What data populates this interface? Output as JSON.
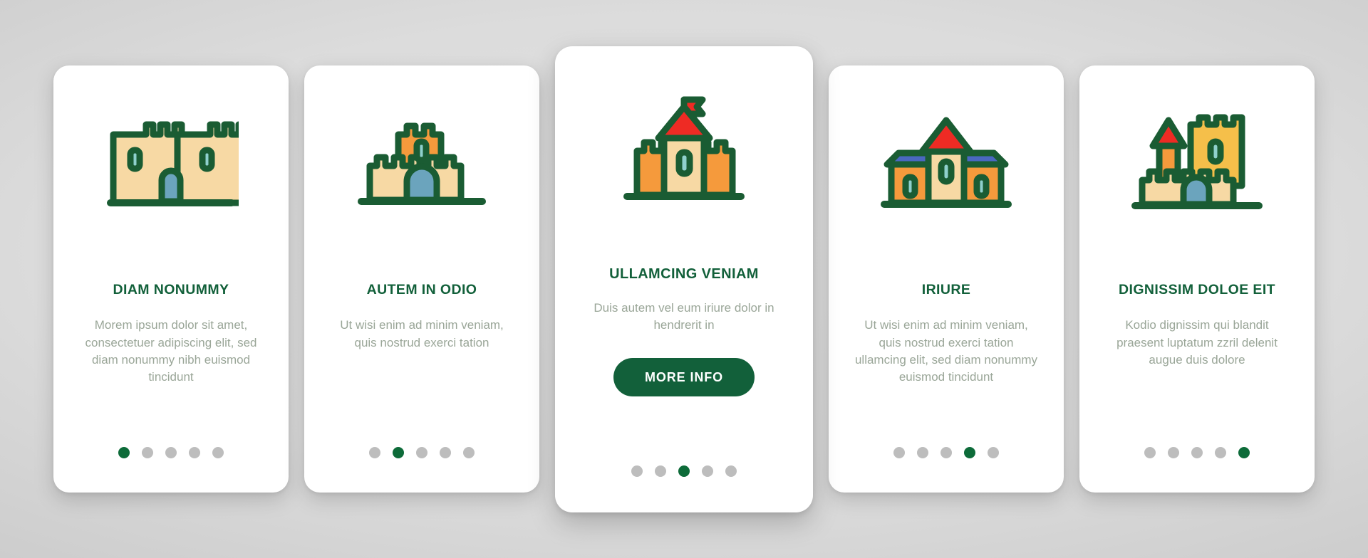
{
  "theme": {
    "accent_green": "#12603a",
    "dot_active": "#0d6b39",
    "dot_inactive": "#bdbdbd",
    "body_text": "#9aa698",
    "card_bg": "#ffffff",
    "page_bg": "#d8d8d8",
    "icon_outline": "#1a5c33",
    "icon_tan": "#f7d9a4",
    "icon_orange": "#f59a3c",
    "icon_gold": "#f5bf4a",
    "icon_red": "#ee2b24",
    "icon_blue": "#6ba4bd",
    "icon_teal": "#8fd0cd",
    "icon_roof_blue": "#4a68c0"
  },
  "cards": [
    {
      "icon_name": "castle-twin-towers-icon",
      "title": "DIAM NONUMMY",
      "body": "Morem ipsum dolor sit amet, consectetuer adipiscing elit, sed diam nonummy nibh euismod tincidunt",
      "dots": {
        "count": 5,
        "active_index": 0
      },
      "featured": false
    },
    {
      "icon_name": "castle-keep-gate-icon",
      "title": "AUTEM IN ODIO",
      "body": "Ut wisi enim ad minim veniam, quis nostrud exerci tation",
      "dots": {
        "count": 5,
        "active_index": 1
      },
      "featured": false
    },
    {
      "icon_name": "castle-flag-tower-icon",
      "title": "ULLAMCING VENIAM",
      "body": "Duis autem vel eum iriure dolor in hendrerit in",
      "button_label": "MORE INFO",
      "dots": {
        "count": 5,
        "active_index": 2
      },
      "featured": true
    },
    {
      "icon_name": "castle-manor-house-icon",
      "title": "IRIURE",
      "body": "Ut wisi enim ad minim veniam, quis nostrud exerci tation ullamcing elit, sed diam nonummy euismod tincidunt",
      "dots": {
        "count": 5,
        "active_index": 3
      },
      "featured": false
    },
    {
      "icon_name": "castle-turret-wall-icon",
      "title": "DIGNISSIM DOLOE EIT",
      "body": "Kodio dignissim qui blandit praesent luptatum zzril delenit augue duis dolore",
      "dots": {
        "count": 5,
        "active_index": 4
      },
      "featured": false
    }
  ]
}
